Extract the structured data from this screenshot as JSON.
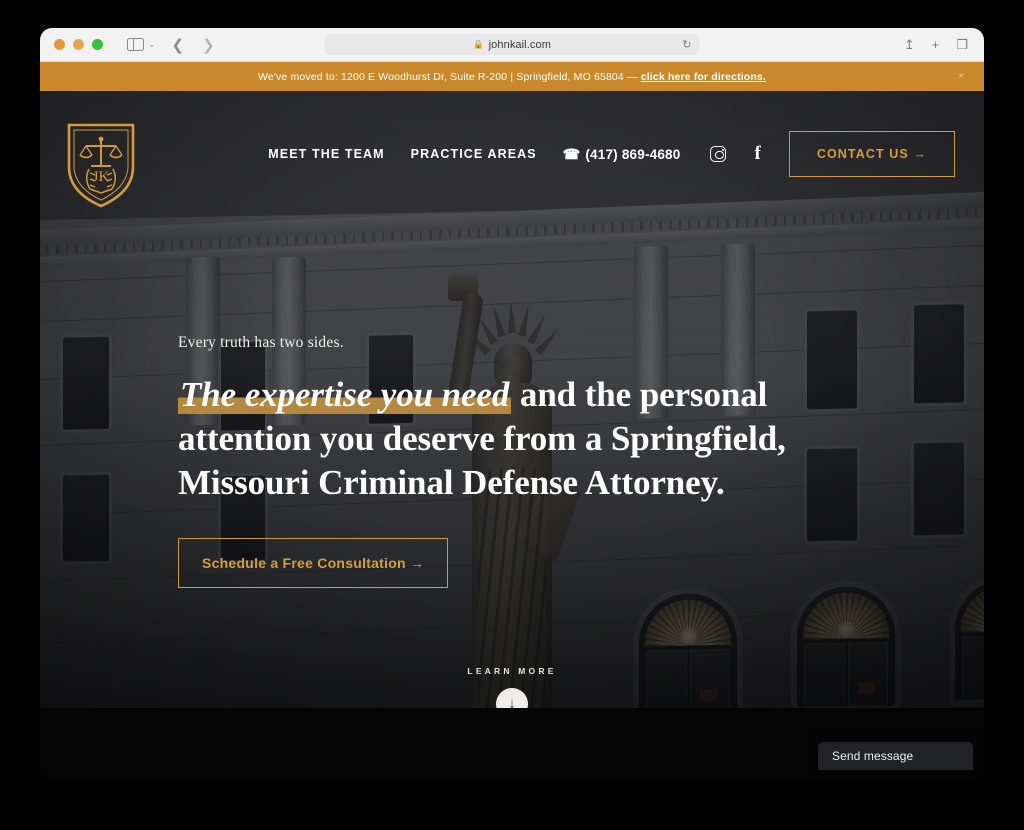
{
  "browser": {
    "url": "johnkail.com",
    "lock_icon": "lock-icon",
    "reload_icon": "reload-icon",
    "sidebar_icon": "sidebar-icon",
    "back_icon": "back-arrow-icon",
    "forward_icon": "forward-arrow-icon",
    "share_icon": "share-icon",
    "new_tab_icon": "plus-icon",
    "tabs_icon": "tab-overview-icon",
    "traffic_lights": [
      "close",
      "minimize",
      "zoom"
    ]
  },
  "banner": {
    "text": "We've moved to: 1200 E Woodhurst Dr, Suite R-200 | Springfield, MO 65804 — ",
    "link": "click here for directions.",
    "close": "×",
    "bg_color": "#c9882c"
  },
  "header": {
    "logo_alt": "JK shield logo with scales of justice",
    "nav": [
      {
        "label": "MEET THE TEAM"
      },
      {
        "label": "PRACTICE AREAS"
      }
    ],
    "phone_icon": "☎",
    "phone": "(417) 869-4680",
    "instagram_icon": "instagram-icon",
    "facebook_icon": "f",
    "cta_label": "CONTACT US →",
    "accent_color": "#d79e3e"
  },
  "hero": {
    "eyebrow": "Every truth has two sides.",
    "headline_highlight": "The expertise you need",
    "headline_rest": " and the personal attention you deserve from a Springfield, Missouri Criminal Defense Attorney.",
    "cta_label": "Schedule a Free Consultation →",
    "highlight_color": "#b58842",
    "scroll_label": "LEARN MORE",
    "scroll_icon": "↓"
  },
  "chat": {
    "label": "Send message"
  }
}
